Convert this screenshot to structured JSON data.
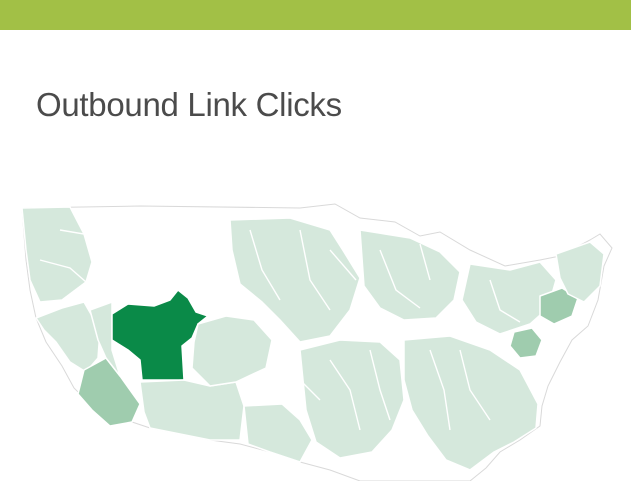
{
  "header": {
    "bar_color": "#a2c046"
  },
  "card": {
    "title": "Outbound Link Clicks"
  },
  "map": {
    "region": "United States",
    "resolution": "metro",
    "colors": {
      "none": "#ffffff",
      "low": "#d5e8dc",
      "medium": "#9fccae",
      "high": "#0a8a48",
      "border": "#ffffff",
      "outline": "#d9d9d9"
    },
    "regions": [
      {
        "name": "pacific-northwest",
        "level": "low"
      },
      {
        "name": "northern-california",
        "level": "low"
      },
      {
        "name": "los-angeles",
        "level": "medium"
      },
      {
        "name": "nevada",
        "level": "low"
      },
      {
        "name": "salt-lake-city",
        "level": "high"
      },
      {
        "name": "arizona",
        "level": "low"
      },
      {
        "name": "colorado",
        "level": "low"
      },
      {
        "name": "texas",
        "level": "low"
      },
      {
        "name": "midwest",
        "level": "low"
      },
      {
        "name": "great-lakes",
        "level": "low"
      },
      {
        "name": "south",
        "level": "low"
      },
      {
        "name": "southeast",
        "level": "low"
      },
      {
        "name": "northeast",
        "level": "low"
      },
      {
        "name": "new-york",
        "level": "medium"
      },
      {
        "name": "washington-dc",
        "level": "medium"
      },
      {
        "name": "new-england",
        "level": "low"
      }
    ]
  }
}
